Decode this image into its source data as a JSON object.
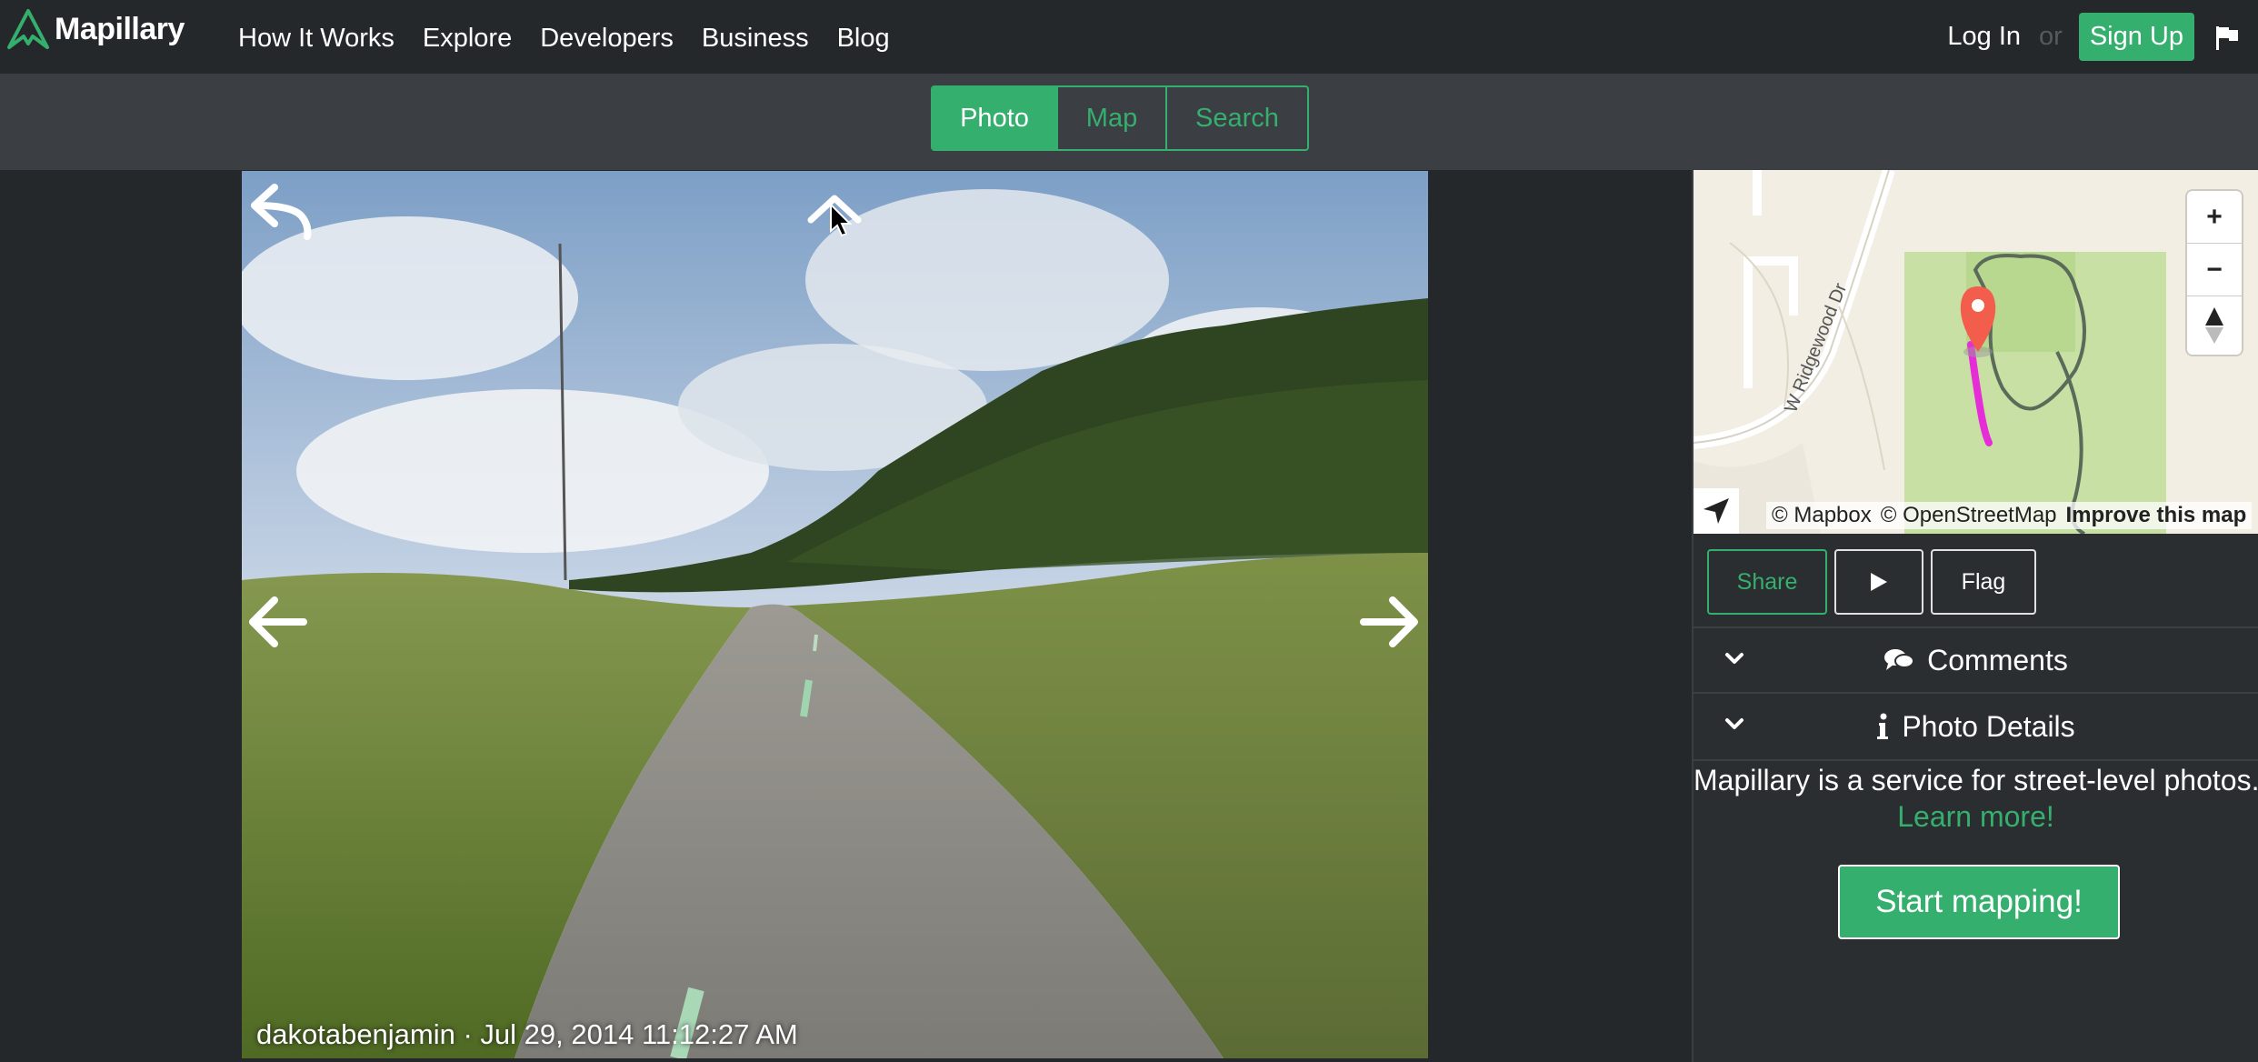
{
  "brand": {
    "name": "Mapillary",
    "accent": "#35af6d"
  },
  "nav": {
    "links": [
      "How It Works",
      "Explore",
      "Developers",
      "Business",
      "Blog"
    ],
    "login": "Log In",
    "or": "or",
    "signup": "Sign Up"
  },
  "view_tabs": {
    "photo": "Photo",
    "map": "Map",
    "search": "Search",
    "active": "Photo"
  },
  "photo": {
    "caption": "dakotabenjamin · Jul 29, 2014 11:12:27 AM"
  },
  "map": {
    "street_label": "W Ridgewood Dr",
    "zoom_in": "+",
    "zoom_out": "−",
    "attribution": {
      "mapbox": "© Mapbox",
      "osm": "© OpenStreetMap",
      "improve": "Improve this map"
    }
  },
  "actions": {
    "share": "Share",
    "flag": "Flag"
  },
  "sections": {
    "comments": "Comments",
    "photo_details": "Photo Details"
  },
  "promo": {
    "text": "Mapillary is a service for street-level photos.",
    "learn_more": "Learn more!",
    "cta": "Start mapping!"
  }
}
